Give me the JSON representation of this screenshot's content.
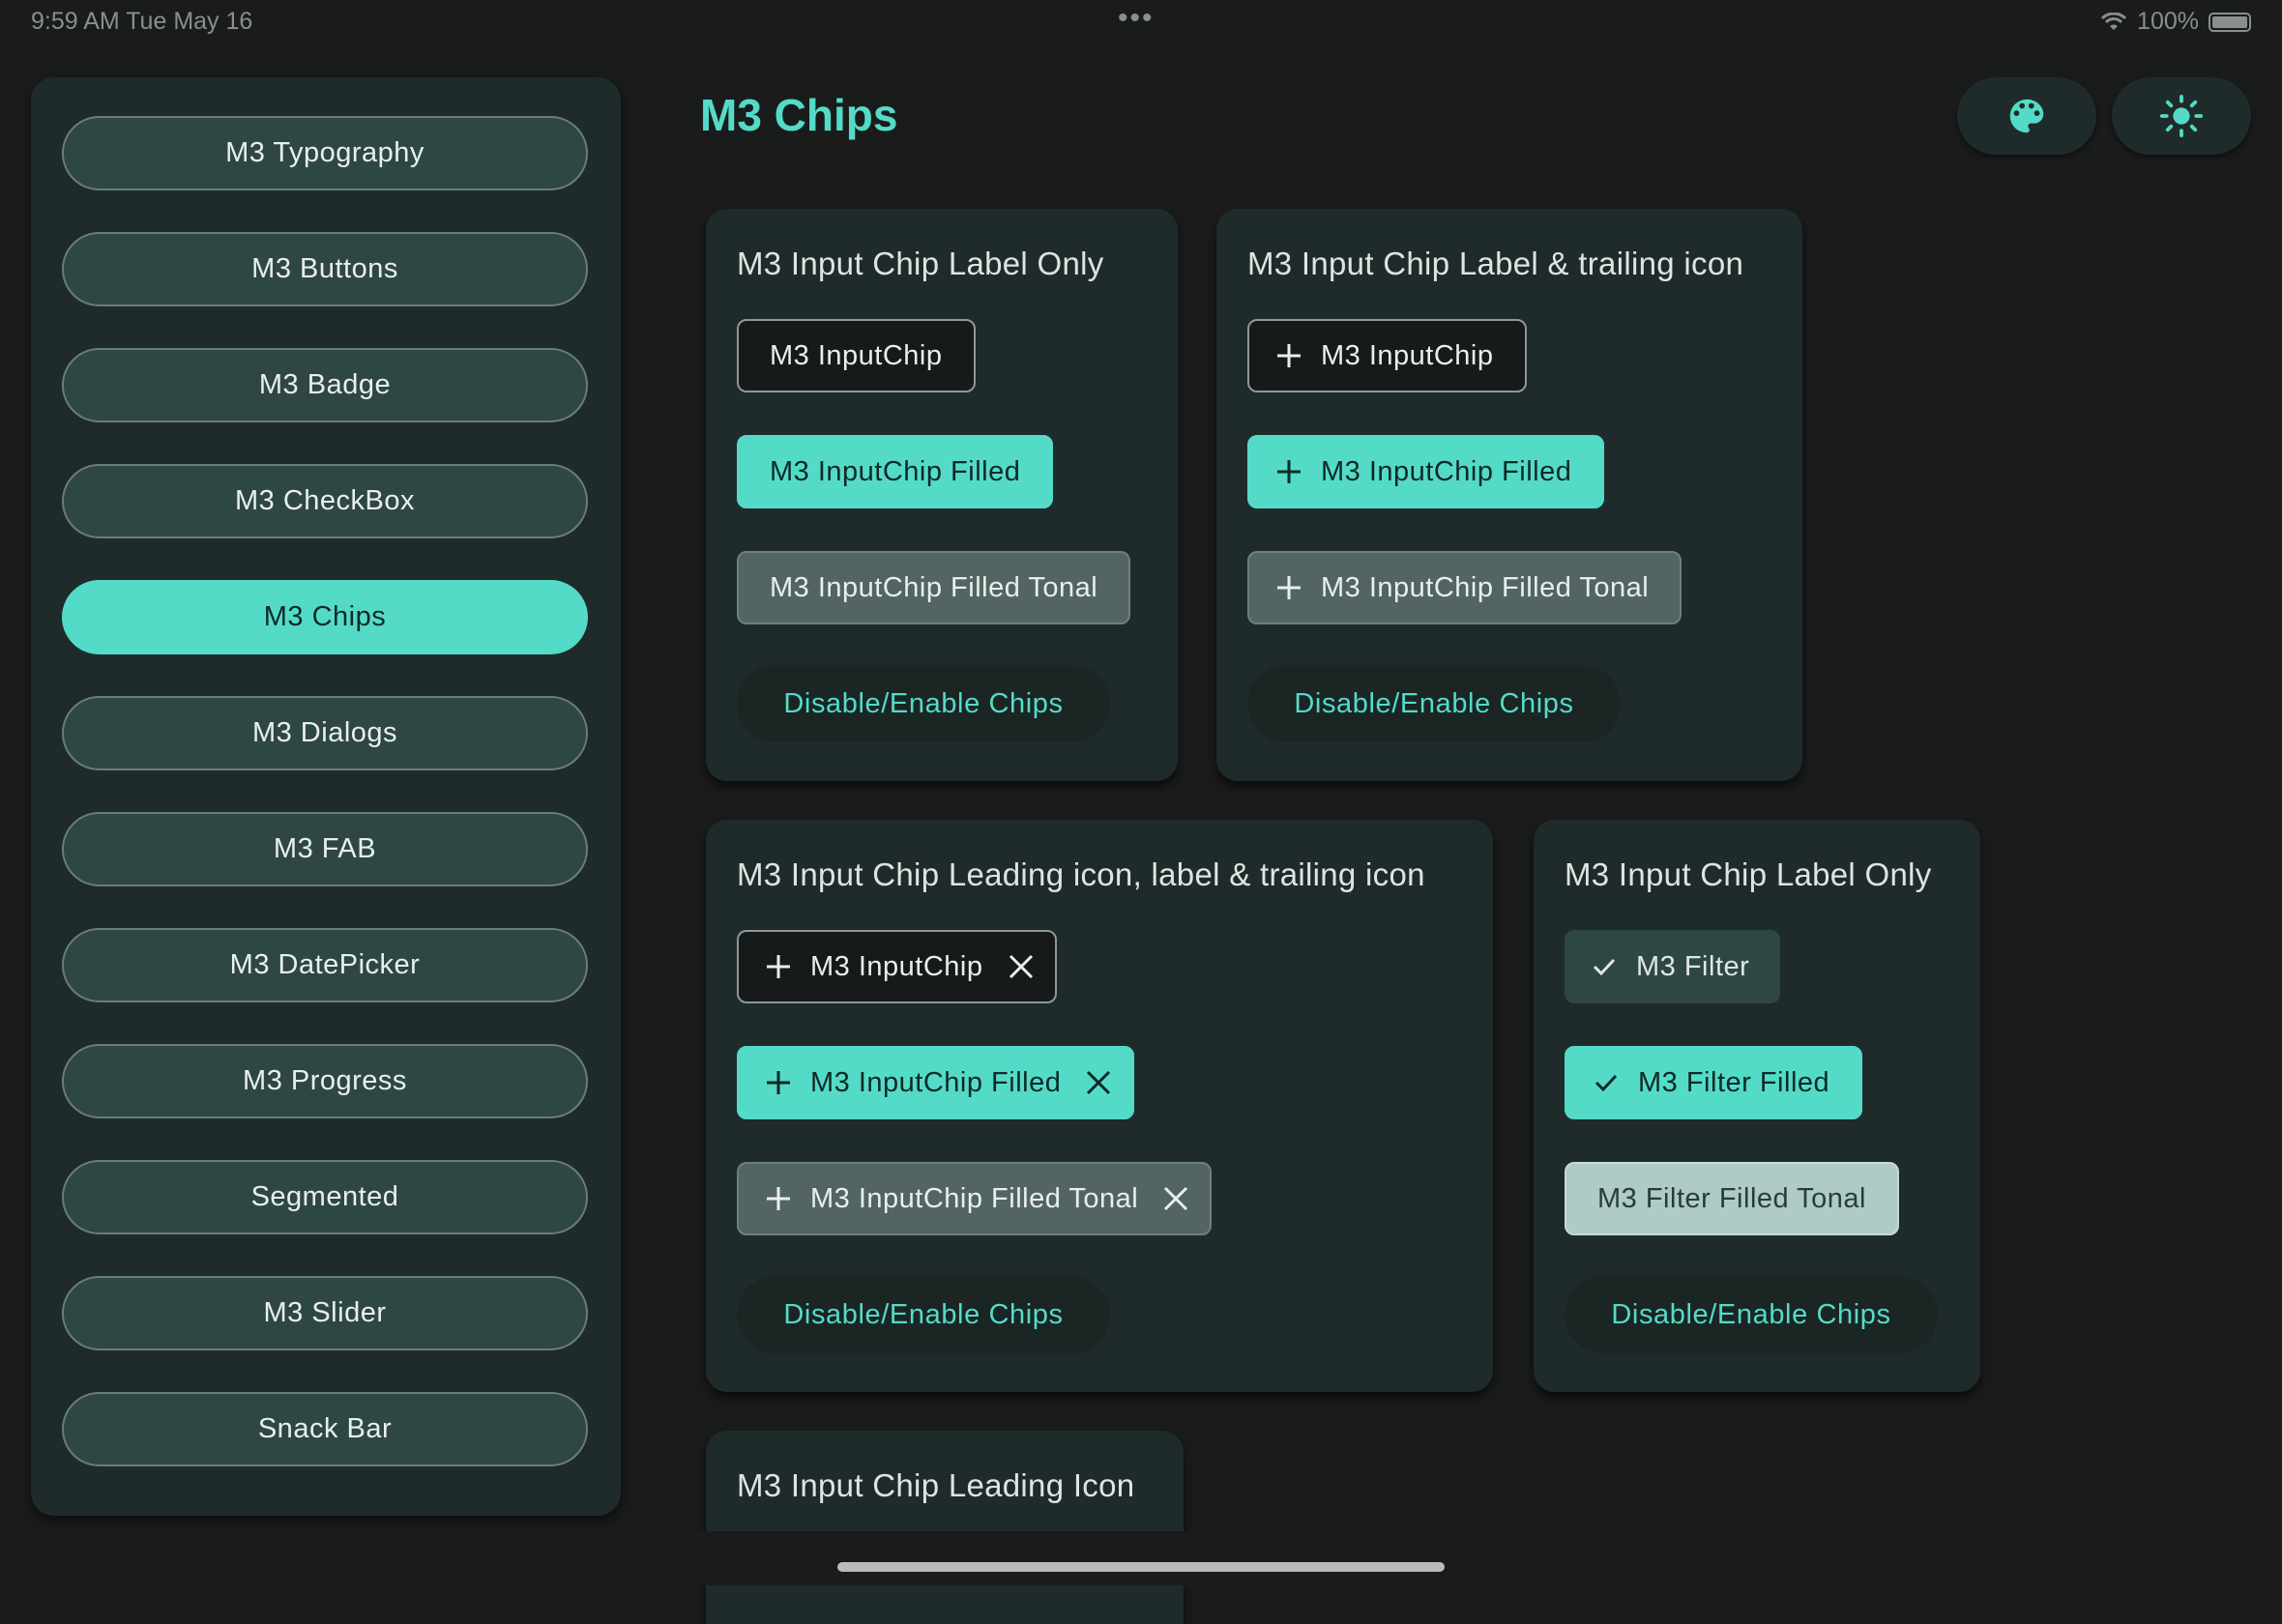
{
  "status_bar": {
    "time": "9:59 AM   Tue May 16",
    "battery": "100%"
  },
  "sidebar": {
    "items": [
      {
        "label": "M3 Typography"
      },
      {
        "label": "M3 Buttons"
      },
      {
        "label": "M3 Badge"
      },
      {
        "label": "M3 CheckBox"
      },
      {
        "label": "M3 Chips",
        "selected": true
      },
      {
        "label": "M3 Dialogs"
      },
      {
        "label": "M3 FAB"
      },
      {
        "label": "M3 DatePicker"
      },
      {
        "label": "M3 Progress"
      },
      {
        "label": "Segmented"
      },
      {
        "label": "M3 Slider"
      },
      {
        "label": "Snack Bar"
      }
    ]
  },
  "header": {
    "title": "M3 Chips",
    "palette_icon": "palette-icon",
    "theme_icon": "sun-icon"
  },
  "cards": [
    {
      "title": "M3 Input Chip Label Only",
      "chips": [
        "M3 InputChip",
        "M3 InputChip Filled",
        "M3 InputChip Filled Tonal"
      ],
      "toggle": "Disable/Enable Chips"
    },
    {
      "title": "M3 Input Chip Label & trailing icon",
      "chips": [
        "M3 InputChip",
        "M3 InputChip Filled",
        "M3 InputChip Filled Tonal"
      ],
      "toggle": "Disable/Enable Chips"
    },
    {
      "title": "M3 Input Chip Leading icon, label & trailing icon",
      "chips": [
        "M3 InputChip",
        "M3 InputChip Filled",
        "M3 InputChip Filled Tonal"
      ],
      "toggle": "Disable/Enable Chips"
    },
    {
      "title": "M3 Input Chip Label Only",
      "chips": [
        "M3 Filter",
        "M3 Filter Filled",
        "M3 Filter Filled Tonal"
      ],
      "toggle": "Disable/Enable Chips"
    },
    {
      "title": "M3 Input Chip Leading Icon"
    }
  ],
  "colors": {
    "accent": "#54dbc8",
    "background": "#1a1c1c",
    "surface": "#1f2b2a",
    "sidebar_button": "#2f4744",
    "tonal": "#536562"
  }
}
